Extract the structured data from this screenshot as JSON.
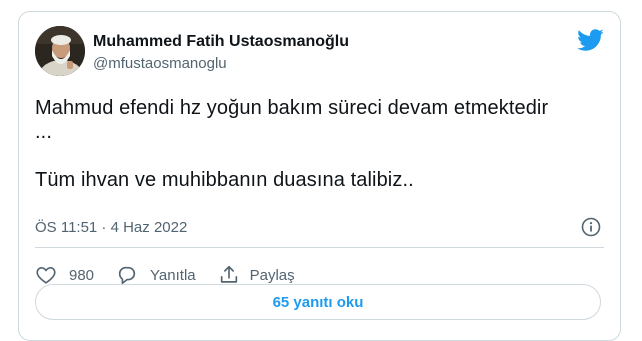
{
  "author": {
    "name": "Muhammed Fatih Ustaosmanoğlu",
    "handle": "@mfustaosmanoglu",
    "avatar_icon": "profile-photo-avatar"
  },
  "brand": {
    "icon": "twitter-bird-icon",
    "color": "#1d9bf0"
  },
  "tweet": {
    "text": "Mahmud efendi hz yoğun bakım süreci devam etmektedir\n...\n\nTüm ihvan ve muhibbanın duasına talibiz..",
    "timestamp": "ÖS 11:51 · 4 Haz 2022"
  },
  "actions": {
    "like_count": "980",
    "reply_label": "Yanıtla",
    "share_label": "Paylaş"
  },
  "replies_button": {
    "label": "65 yanıtı oku"
  },
  "colors": {
    "text": "#0f1419",
    "secondary": "#536471",
    "border": "#cfd9de",
    "accent": "#1d9bf0"
  }
}
